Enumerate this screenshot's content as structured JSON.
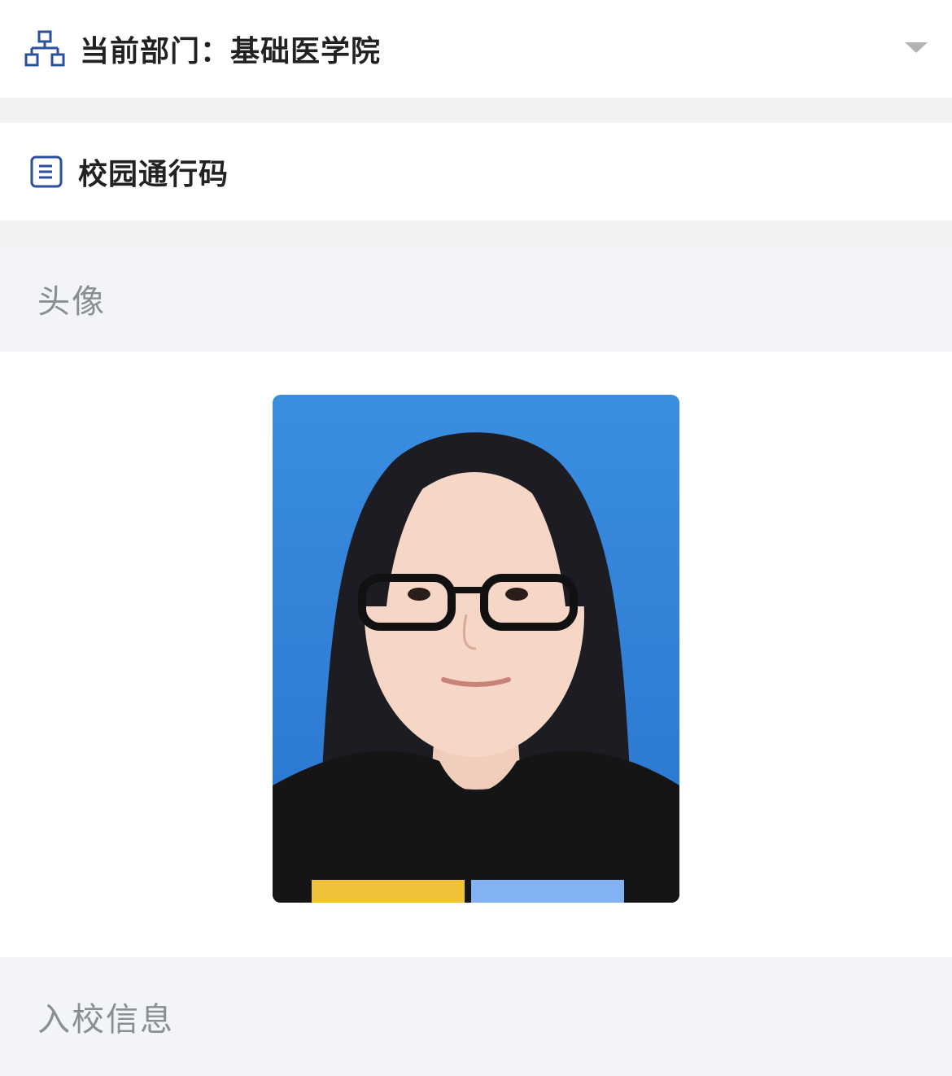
{
  "department": {
    "prefix": "当前部门：",
    "name": "基础医学院",
    "icon": "org-structure-icon",
    "dropdown_icon": "caret-down-icon"
  },
  "campus_pass": {
    "label": "校园通行码",
    "icon": "document-list-icon"
  },
  "avatar_section": {
    "title": "头像"
  },
  "admission_section": {
    "title": "入校信息"
  },
  "colors": {
    "accent": "#2b4f9e",
    "photo_background": "#2d7fd6"
  }
}
